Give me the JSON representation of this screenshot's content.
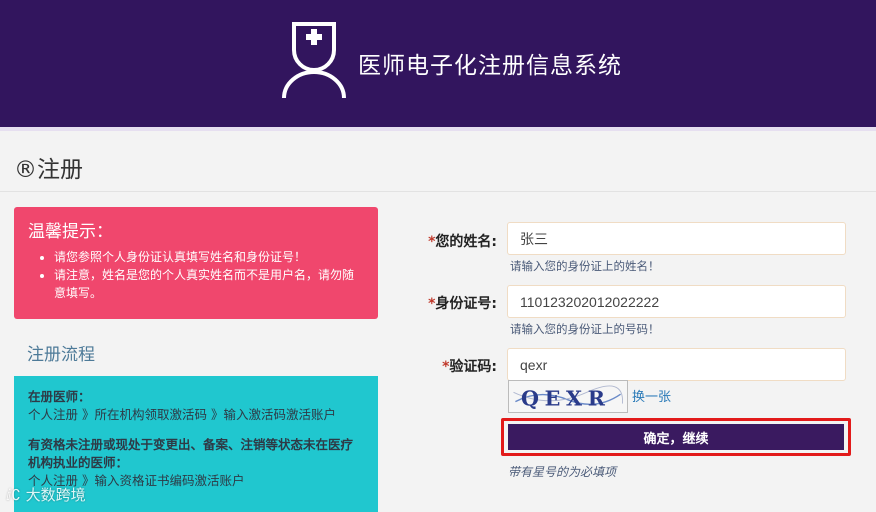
{
  "header": {
    "app_title": "医师电子化注册信息系统",
    "logo_icon": "doctor-nurse-icon",
    "bg_color": "#32155e"
  },
  "page": {
    "title": "®注册"
  },
  "tips": {
    "title": "温馨提示：",
    "items": [
      "请您参照个人身份证认真填写姓名和身份证号！",
      "请注意，姓名是您的个人真实姓名而不是用户名，请勿随意填写。"
    ],
    "bg_color": "#f0476d"
  },
  "process": {
    "title": "注册流程",
    "registered_label": "在册医师：",
    "registered_steps": "个人注册 》所在机构领取激活码 》输入激活码激活账户",
    "qualified_label": "有资格未注册或现处于变更出、备案、注销等状态未在医疗机构执业的医师：",
    "qualified_steps": "个人注册 》输入资格证书编码激活账户",
    "bg_color": "#20c7cf"
  },
  "form": {
    "name": {
      "star": "*",
      "label": "您的姓名:",
      "value": "张三",
      "hint": "请输入您的身份证上的姓名！"
    },
    "idcard": {
      "star": "*",
      "label": "身份证号:",
      "value": "110123202012022222",
      "hint": "请输入您的身份证上的号码！"
    },
    "captcha": {
      "star": "*",
      "label": "验证码:",
      "value": "qexr",
      "image_text": "QEXR",
      "refresh": "换一张"
    },
    "submit_label": "确定，继续",
    "required_note": "带有星号的为必填项"
  },
  "watermark": {
    "text": "大数跨境",
    "icon": "loop-logo-icon"
  }
}
